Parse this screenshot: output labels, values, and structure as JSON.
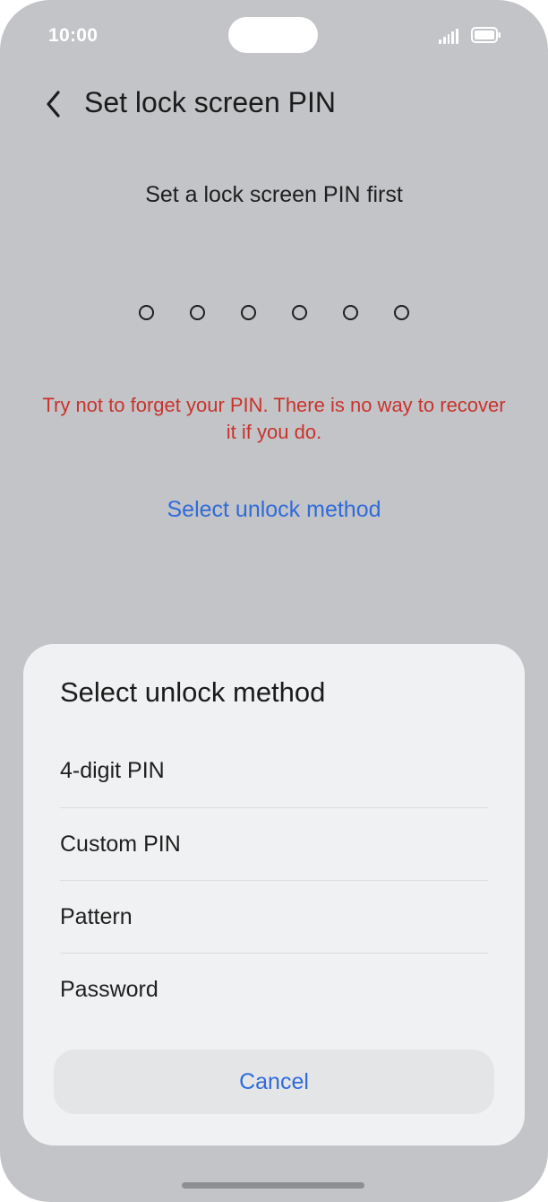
{
  "status_bar": {
    "time": "10:00",
    "signal_icon": "signal-icon",
    "battery_icon": "battery-icon"
  },
  "header": {
    "back_icon": "chevron-left-icon",
    "title": "Set lock screen PIN"
  },
  "main": {
    "prompt": "Set a lock screen PIN first",
    "pin_length": 6,
    "pin_entered": 0,
    "warning": "Try not to forget your PIN. There is no way to recover it if you do.",
    "select_method_link": "Select unlock method"
  },
  "sheet": {
    "title": "Select unlock method",
    "options": [
      {
        "label": "4-digit PIN"
      },
      {
        "label": "Custom PIN"
      },
      {
        "label": "Pattern"
      },
      {
        "label": "Password"
      }
    ],
    "cancel_label": "Cancel"
  },
  "colors": {
    "background_dimmed": "#c3c4c7",
    "sheet_background": "#f0f1f2",
    "accent_blue": "#2f6bd9",
    "warning_red": "#c9322d"
  }
}
